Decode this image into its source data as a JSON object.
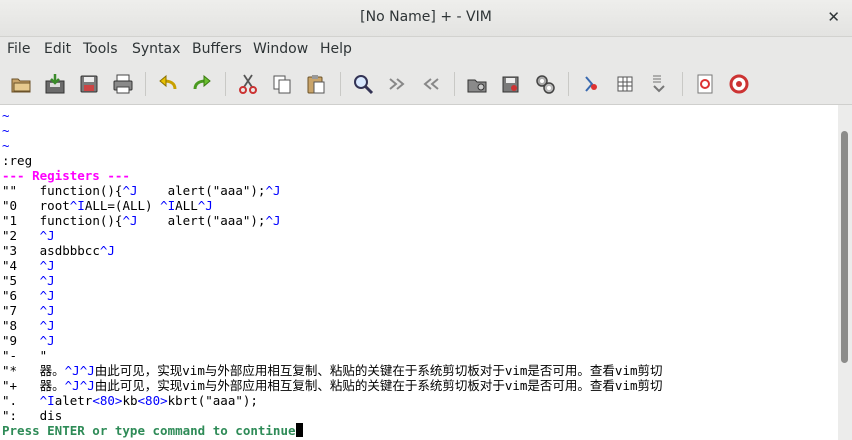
{
  "window": {
    "title": "[No Name] + - VIM",
    "close_glyph": "✕"
  },
  "menu": [
    "File",
    "Edit",
    "Tools",
    "Syntax",
    "Buffers",
    "Window",
    "Help"
  ],
  "toolbar_icons": [
    "open-file-icon",
    "save-icon",
    "save-all-icon",
    "print-icon",
    "undo-icon",
    "redo-icon",
    "cut-icon",
    "copy-icon",
    "paste-icon",
    "find-replace-icon",
    "find-next-icon",
    "find-prev-icon",
    "load-session-icon",
    "save-session-icon",
    "run-script-icon",
    "make-icon",
    "ctags-icon",
    "jump-tag-icon",
    "help-icon",
    "find-help-icon"
  ],
  "terminal": {
    "tildes": [
      "~",
      "~",
      "~"
    ],
    "command": ":reg",
    "header": "--- Registers ---",
    "registers": [
      {
        "name": "\"\"",
        "parts": [
          "function(){",
          "^J",
          "    alert(\"aaa\");",
          "^J"
        ]
      },
      {
        "name": "\"0",
        "parts": [
          "root",
          "^I",
          "ALL=(ALL) ",
          "^I",
          "ALL",
          "^J"
        ]
      },
      {
        "name": "\"1",
        "parts": [
          "function(){",
          "^J",
          "    alert(\"aaa\");",
          "^J"
        ]
      },
      {
        "name": "\"2",
        "parts": [
          "",
          "^J"
        ]
      },
      {
        "name": "\"3",
        "parts": [
          "asdbbbcc",
          "^J"
        ]
      },
      {
        "name": "\"4",
        "parts": [
          "",
          "^J"
        ]
      },
      {
        "name": "\"5",
        "parts": [
          "",
          "^J"
        ]
      },
      {
        "name": "\"6",
        "parts": [
          "",
          "^J"
        ]
      },
      {
        "name": "\"7",
        "parts": [
          "",
          "^J"
        ]
      },
      {
        "name": "\"8",
        "parts": [
          "",
          "^J"
        ]
      },
      {
        "name": "\"9",
        "parts": [
          "",
          "^J"
        ]
      },
      {
        "name": "\"-",
        "parts": [
          "\""
        ]
      },
      {
        "name": "\"*",
        "parts": [
          "器。",
          "^J^J",
          "由此可见，实现vim与外部应用相互复制、粘贴的关键在于系统剪切板对于vim是否可用。查看vim剪切"
        ]
      },
      {
        "name": "\"+",
        "parts": [
          "器。",
          "^J^J",
          "由此可见，实现vim与外部应用相互复制、粘贴的关键在于系统剪切板对于vim是否可用。查看vim剪切"
        ]
      },
      {
        "name": "\".",
        "parts": [
          "",
          "^I",
          "aletr",
          "<80>",
          "kb",
          "<80>",
          "kbrt(\"aaa\");"
        ]
      },
      {
        "name": "\":",
        "parts": [
          "dis"
        ]
      }
    ],
    "prompt": "Press ENTER or type command to continue"
  }
}
